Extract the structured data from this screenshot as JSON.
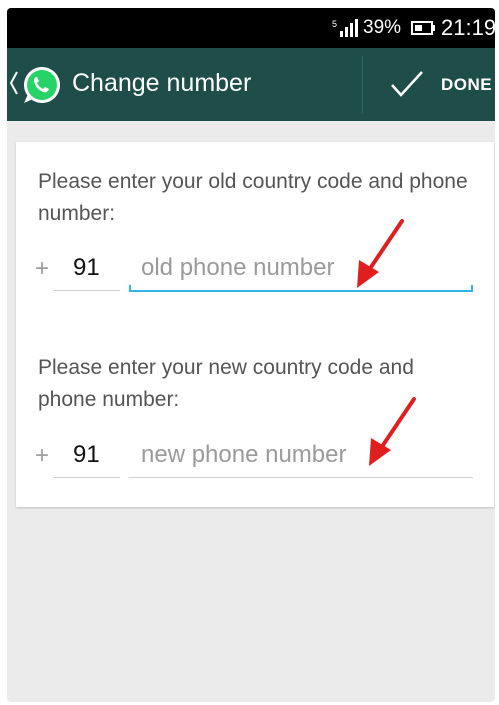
{
  "status_bar": {
    "network_badge": "5",
    "battery_percent": "39%",
    "time": "21:19"
  },
  "action_bar": {
    "title": "Change number",
    "done_label": "DONE"
  },
  "form": {
    "old": {
      "prompt": "Please enter your old country code and phone number:",
      "country_code_prefix": "+",
      "country_code": "91",
      "phone_placeholder": "old phone number"
    },
    "new": {
      "prompt": "Please enter your new country code and phone number:",
      "country_code_prefix": "+",
      "country_code": "91",
      "phone_placeholder": "new phone number"
    }
  },
  "icons": {
    "back": "chevron-left-icon",
    "logo": "whatsapp-logo-icon",
    "done": "checkmark-icon",
    "annotation": "red-arrow-icon"
  },
  "colors": {
    "action_bar": "#1f4e4a",
    "logo_green": "#25d366",
    "focus_underline": "#33b5e5",
    "annotation_arrow": "#e01e1e"
  }
}
